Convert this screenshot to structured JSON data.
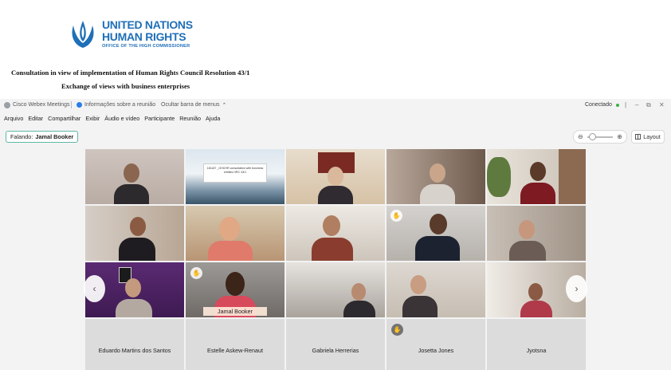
{
  "document": {
    "logo": {
      "line1": "UNITED NATIONS",
      "line2": "HUMAN RIGHTS",
      "line3": "OFFICE OF THE HIGH COMMISSIONER"
    },
    "title": "Consultation in view of implementation of Human Rights Council Resolution 43/1",
    "subtitle": "Exchange of views with business enterprises"
  },
  "titlebar": {
    "app_name": "Cisco Webex Meetings",
    "meeting_info": "Informações sobre a reunião",
    "hide_menu": "Ocultar barra de menus",
    "status": "Conectado",
    "minimize": "–",
    "restore": "⧉",
    "close": "✕"
  },
  "menu": [
    "Arquivo",
    "Editar",
    "Compartilhar",
    "Exibir",
    "Áudio e vídeo",
    "Participante",
    "Reunião",
    "Ajuda"
  ],
  "speaking": {
    "label": "Falando:",
    "name": "Jamal Booker"
  },
  "layout_button": "Layout",
  "shared_screen_text": "181187 _OHCHR consultation with business entities HRC 43/1",
  "active_tile_name": "Jamal Booker",
  "name_tiles": [
    "Eduardo Martins dos Santos",
    "Estelle Askew-Renaut",
    "Gabriela Herrerias",
    "Josetta Jones",
    "Jyotsna"
  ],
  "colors": {
    "accent": "#49b0ff",
    "status_green": "#3cb043",
    "un_blue": "#1f6fb8"
  }
}
